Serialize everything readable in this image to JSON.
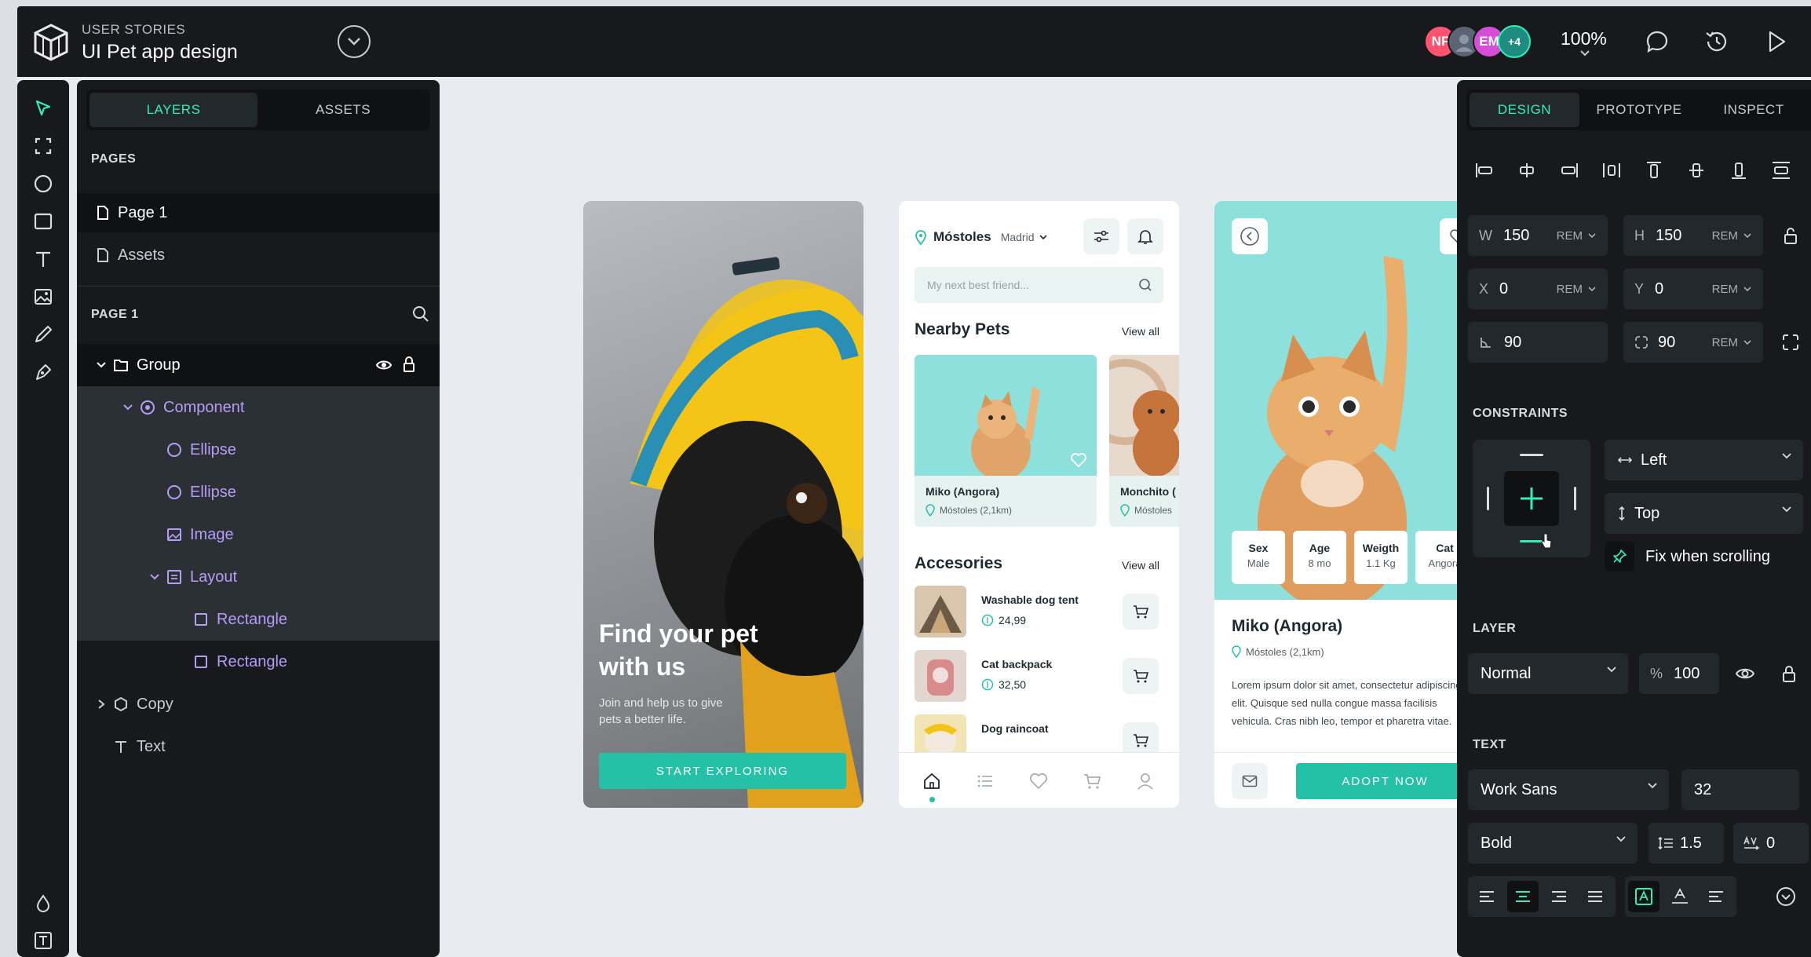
{
  "project": {
    "category": "USER STORIES",
    "title": "UI Pet app design"
  },
  "collaborators": [
    {
      "initials": "NF",
      "color": "#ff5370"
    },
    {
      "initials": "",
      "color": "#5a6473"
    },
    {
      "initials": "EM",
      "color": "#d64dd6"
    },
    {
      "initials": "+4",
      "color": "#1e8c7e"
    }
  ],
  "zoom": "100%",
  "left_panel": {
    "tabs": [
      "LAYERS",
      "ASSETS"
    ],
    "pages_title": "PAGES",
    "pages": [
      "Page 1",
      "Assets"
    ],
    "layers_title": "PAGE 1",
    "layers": [
      {
        "name": "Group",
        "icon": "folder-icon"
      },
      {
        "name": "Component",
        "icon": "component-icon"
      },
      {
        "name": "Ellipse",
        "icon": "ellipse-icon"
      },
      {
        "name": "Ellipse",
        "icon": "ellipse-icon"
      },
      {
        "name": "Image",
        "icon": "image-icon"
      },
      {
        "name": "Layout",
        "icon": "layout-icon"
      },
      {
        "name": "Rectangle",
        "icon": "rectangle-icon"
      },
      {
        "name": "Rectangle",
        "icon": "rectangle-icon"
      },
      {
        "name": "Copy",
        "icon": "hexagon-icon"
      },
      {
        "name": "Text",
        "icon": "text-icon"
      }
    ]
  },
  "screen1": {
    "title": "Find your pet with us",
    "subtitle": "Join and help us to give pets a better life.",
    "cta": "START EXPLORING"
  },
  "screen2": {
    "location": "Móstoles",
    "region": "Madrid",
    "search_placeholder": "My next best friend...",
    "nearby_title": "Nearby Pets",
    "view_all": "View all",
    "pets": [
      {
        "name": "Miko (Angora)",
        "location": "Móstoles (2,1km)"
      },
      {
        "name": "Monchito (",
        "location": "Móstoles"
      }
    ],
    "accessories_title": "Accesories",
    "accessories": [
      {
        "name": "Washable dog tent",
        "price": "24,99"
      },
      {
        "name": "Cat backpack",
        "price": "32,50"
      },
      {
        "name": "Dog raincoat",
        "price": ""
      }
    ]
  },
  "screen3": {
    "attributes": [
      {
        "key": "Sex",
        "value": "Male"
      },
      {
        "key": "Age",
        "value": "8 mo"
      },
      {
        "key": "Weigth",
        "value": "1.1 Kg"
      },
      {
        "key": "Cat",
        "value": "Angora"
      }
    ],
    "name": "Miko (Angora)",
    "location": "Móstoles (2,1km)",
    "description": "Lorem ipsum dolor sit amet, consectetur adipiscing elit. Quisque sed nulla congue massa facilisis vehicula. Cras nibh leo, tempor et pharetra vitae.",
    "cta": "ADOPT NOW"
  },
  "right_panel": {
    "tabs": [
      "DESIGN",
      "PROTOTYPE",
      "INSPECT"
    ],
    "w": {
      "label": "W",
      "value": "150",
      "unit": "REM"
    },
    "h": {
      "label": "H",
      "value": "150",
      "unit": "REM"
    },
    "x": {
      "label": "X",
      "value": "0",
      "unit": "REM"
    },
    "y": {
      "label": "Y",
      "value": "0",
      "unit": "REM"
    },
    "rotation": "90",
    "radius": {
      "value": "90",
      "unit": "REM"
    },
    "constraints_title": "CONSTRAINTS",
    "constraint_h": "Left",
    "constraint_v": "Top",
    "fix_scrolling": "Fix when scrolling",
    "layer_title": "LAYER",
    "blend": "Normal",
    "opacity": {
      "label": "%",
      "value": "100"
    },
    "text_title": "TEXT",
    "font_family": "Work Sans",
    "font_size": "32",
    "font_weight": "Bold",
    "line_height": "1.5",
    "letter_spacing": "0"
  },
  "colors": {
    "accent": "#31efb8",
    "brand_teal": "#25c1a6",
    "panel_bg": "#17191c"
  }
}
